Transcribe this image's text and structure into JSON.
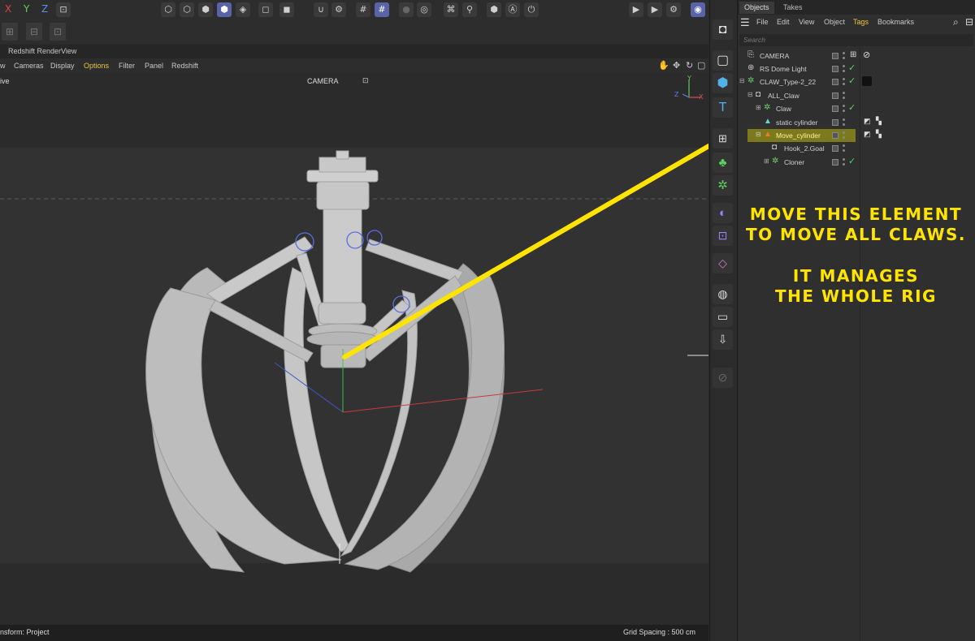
{
  "toolbar": {
    "axes": [
      "X",
      "Y",
      "Z"
    ],
    "axis_colors": [
      "#e04545",
      "#66cc66",
      "#5a8ff0"
    ]
  },
  "viewport": {
    "window_title": "Redshift RenderView",
    "menu": [
      "Cameras",
      "Display",
      "Options",
      "Filter",
      "Panel",
      "Redshift"
    ],
    "menu_left_fragment": "w",
    "active_menu": "Options",
    "perspective_fragment": "ive",
    "camera_label": "CAMERA",
    "grid_spacing": "Grid Spacing : 500 cm",
    "status": "nsform: Project"
  },
  "object_manager": {
    "tabs": [
      "Objects",
      "Takes"
    ],
    "menu": [
      "File",
      "Edit",
      "View",
      "Object",
      "Tags",
      "Bookmarks"
    ],
    "active_menu": "Tags",
    "search_placeholder": "Search",
    "tree": [
      {
        "label": "CAMERA"
      },
      {
        "label": "RS Dome Light"
      },
      {
        "label": "CLAW_Type-2_22"
      },
      {
        "label": "ALL_Claw"
      },
      {
        "label": "Claw"
      },
      {
        "label": "static cylinder"
      },
      {
        "label": "Move_cylinder"
      },
      {
        "label": "Hook_2.Goal"
      },
      {
        "label": "Cloner"
      }
    ]
  },
  "annotation": {
    "line1": "MOVE THIS ELEMENT",
    "line2": "TO MOVE ALL CLAWS.",
    "line3": "IT MANAGES",
    "line4": "THE WHOLE RIG",
    "color": "#ffe400"
  }
}
